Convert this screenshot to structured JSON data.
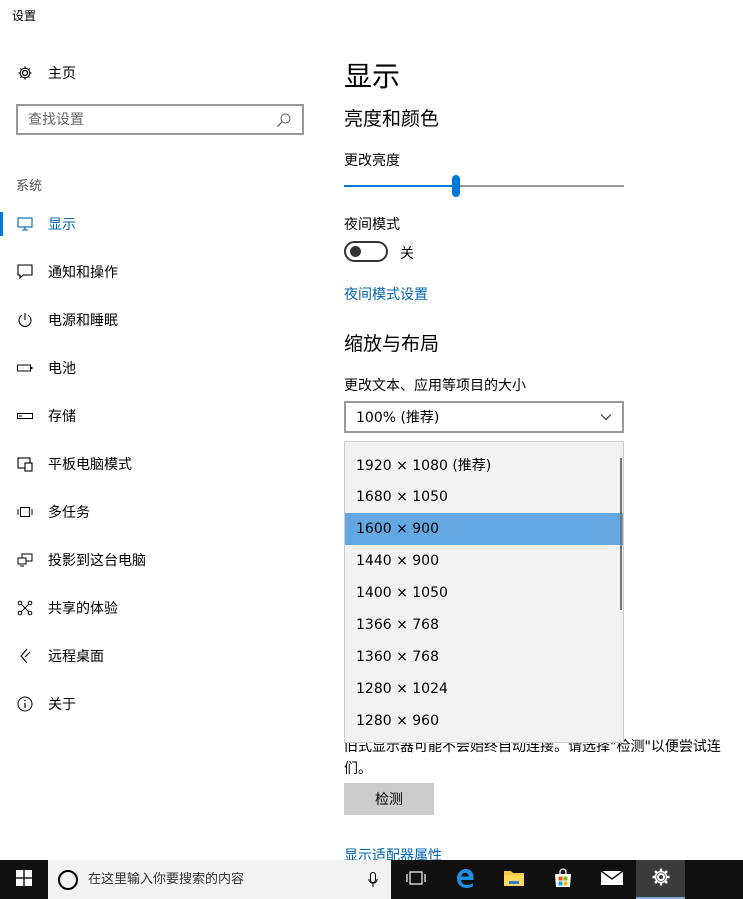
{
  "window": {
    "title": "设置"
  },
  "sidebar": {
    "home_label": "主页",
    "search_placeholder": "查找设置",
    "section_label": "系统",
    "items": [
      {
        "label": "显示",
        "icon": "monitor-icon",
        "active": true
      },
      {
        "label": "通知和操作",
        "icon": "notification-icon"
      },
      {
        "label": "电源和睡眠",
        "icon": "power-icon"
      },
      {
        "label": "电池",
        "icon": "battery-icon"
      },
      {
        "label": "存储",
        "icon": "storage-icon"
      },
      {
        "label": "平板电脑模式",
        "icon": "tablet-mode-icon"
      },
      {
        "label": "多任务",
        "icon": "multitasking-icon"
      },
      {
        "label": "投影到这台电脑",
        "icon": "project-icon"
      },
      {
        "label": "共享的体验",
        "icon": "shared-experiences-icon"
      },
      {
        "label": "远程桌面",
        "icon": "remote-desktop-icon"
      },
      {
        "label": "关于",
        "icon": "info-icon"
      }
    ]
  },
  "main": {
    "title": "显示",
    "brightness_section": "亮度和颜色",
    "brightness_label": "更改亮度",
    "brightness_value": 0.4,
    "night_mode_label": "夜间模式",
    "night_mode_state": "关",
    "night_mode_settings_link": "夜间模式设置",
    "scale_section": "缩放与布局",
    "scale_label": "更改文本、应用等项目的大小",
    "scale_value": "100% (推荐)",
    "resolution_options": [
      "1920 × 1080 (推荐)",
      "1680 × 1050",
      "1600 × 900",
      "1440 × 900",
      "1400 × 1050",
      "1366 × 768",
      "1360 × 768",
      "1280 × 1024",
      "1280 × 960"
    ],
    "resolution_selected": "1600 × 900",
    "detect_text_line1": "旧式显示器可能不会始终自动连接。请选择\"检测\"以便尝试连",
    "detect_text_line2": "们。",
    "detect_button": "检测",
    "adapter_link": "显示适配器属性"
  },
  "taskbar": {
    "search_placeholder": "在这里输入你要搜索的内容",
    "apps": [
      "task-view-icon",
      "edge-icon",
      "file-explorer-icon",
      "store-icon",
      "mail-icon",
      "settings-icon"
    ],
    "accent": "#0078d7"
  }
}
